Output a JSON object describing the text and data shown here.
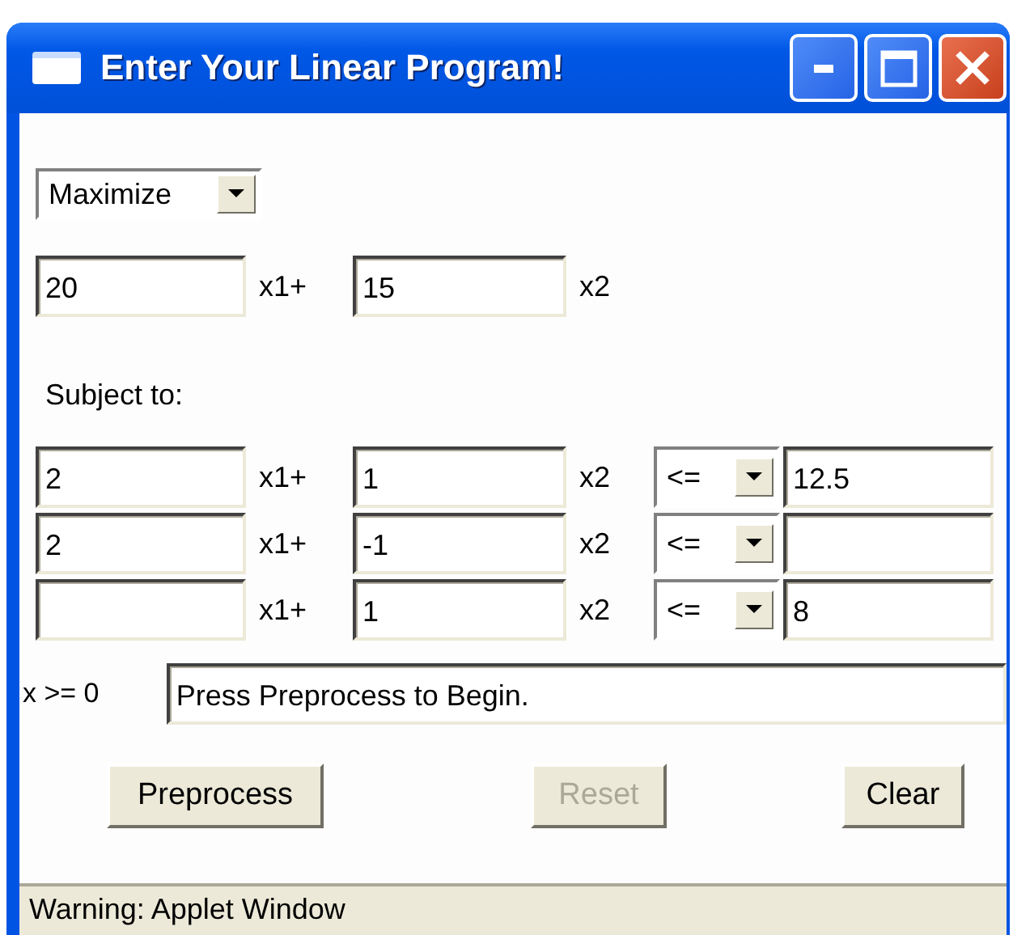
{
  "window": {
    "title": "Enter Your Linear Program!"
  },
  "objective": {
    "sense": "Maximize",
    "coefficient_1": "20",
    "coefficient_2": "15",
    "variables": [
      "x1+",
      "x2"
    ]
  },
  "subject_label": "Subject to:",
  "constraints": [
    {
      "coefficient_1": "2",
      "coefficient_2": "1",
      "variables": [
        "x1+",
        "x2"
      ],
      "operator": "<=",
      "rhs": "12.5"
    },
    {
      "coefficient_1": "2",
      "coefficient_2": "-1",
      "variables": [
        "x1+",
        "x2"
      ],
      "operator": "<="
    },
    {
      "coefficient_2": "1",
      "variables": [
        "x1+",
        "x2"
      ],
      "operator": "<=",
      "rhs": "8"
    }
  ],
  "nonneg_label": "x >= 0",
  "message": "Press Preprocess to Begin.",
  "buttons": [
    {
      "label": "Preprocess",
      "disabled": false
    },
    {
      "label": "Reset",
      "disabled": true
    },
    {
      "label": "Clear",
      "disabled": false
    }
  ],
  "status_bar": "Warning: Applet Window"
}
